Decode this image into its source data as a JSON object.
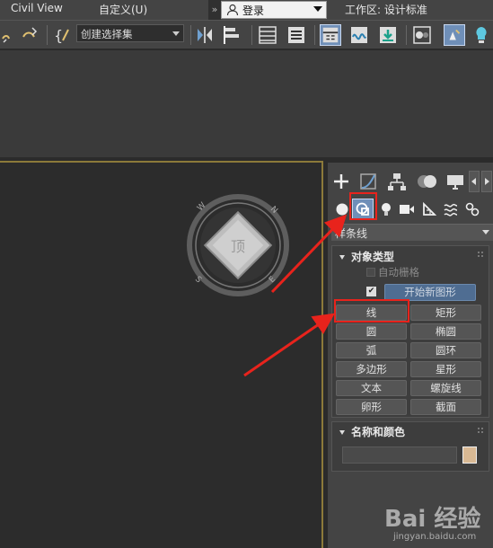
{
  "menubar": {
    "items": [
      "Civil View",
      "自定义(U)"
    ],
    "login_label": "登录",
    "workspace_label": "工作区: 设计标准"
  },
  "toolbar": {
    "selection_set_placeholder": "创建选择集",
    "icons": [
      "link-icon",
      "bind-icon",
      "curly-brace-icon",
      "mirror-icon",
      "align-icon",
      "scene-explorer-icon",
      "layer-icon",
      "ribbon-icon",
      "curve-editor-icon",
      "schematic-icon",
      "material-editor-icon",
      "render-setup-icon",
      "render-icon"
    ]
  },
  "command_panel": {
    "tabs": [
      "create",
      "modify",
      "hierarchy",
      "motion",
      "display",
      "utilities"
    ],
    "subcategories": [
      "geometry",
      "shapes",
      "lights",
      "cameras",
      "helpers",
      "space-warps",
      "systems"
    ],
    "category_dropdown": "样条线",
    "object_type": {
      "title": "对象类型",
      "auto_grid_label": "自动栅格",
      "start_new_shape_label": "开始新图形",
      "start_new_shape_checked": true,
      "buttons": [
        "线",
        "矩形",
        "圆",
        "椭圆",
        "弧",
        "圆环",
        "多边形",
        "星形",
        "文本",
        "螺旋线",
        "卵形",
        "截面"
      ]
    },
    "name_color": {
      "title": "名称和颜色",
      "name_value": "",
      "color": "#d9b994"
    }
  },
  "viewport": {
    "viewcube_labels": [
      "顶"
    ]
  },
  "watermark": {
    "brand": "Bai 经验",
    "url": "jingyan.baidu.com"
  },
  "colors": {
    "highlight": "#e8231c",
    "viewport_border": "#8c7a3a",
    "active_icon": "#6f8fb8"
  }
}
